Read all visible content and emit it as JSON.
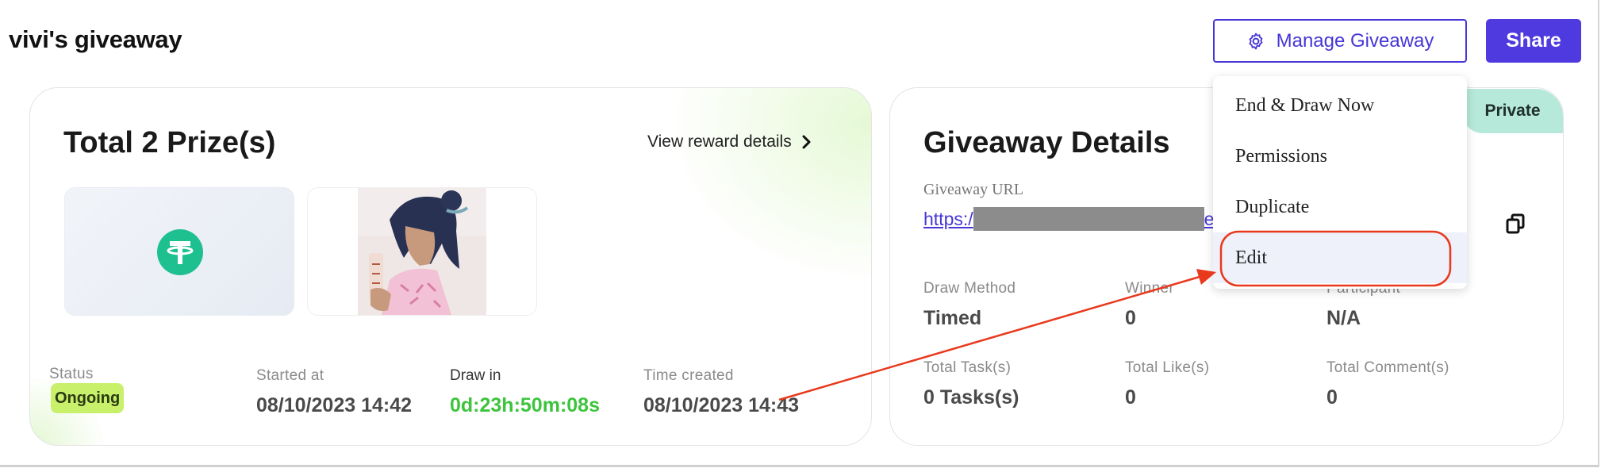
{
  "page": {
    "title": "vivi's giveaway"
  },
  "header": {
    "manage_label": "Manage Giveaway",
    "share_label": "Share"
  },
  "prizes": {
    "title": "Total 2 Prize(s)",
    "view_details_label": "View reward details",
    "status_label": "Status",
    "status_value": "Ongoing",
    "started_label": "Started at",
    "started_value": "08/10/2023 14:42",
    "draw_label": "Draw in",
    "draw_value": "0d:23h:50m:08s",
    "created_label": "Time created",
    "created_value": "08/10/2023 14:43"
  },
  "details": {
    "title": "Giveaway Details",
    "url_label": "Giveaway URL",
    "url_prefix": "https:/",
    "url_suffix": "e",
    "private_label": "Private",
    "stats": [
      {
        "label": "Draw Method",
        "value": "Timed"
      },
      {
        "label": "Winner",
        "value": "0"
      },
      {
        "label": "Participant",
        "value": "N/A"
      },
      {
        "label": "Total Task(s)",
        "value": "0 Tasks(s)"
      },
      {
        "label": "Total Like(s)",
        "value": "0"
      },
      {
        "label": "Total Comment(s)",
        "value": "0"
      }
    ]
  },
  "dropdown": {
    "items": [
      {
        "label": "End & Draw Now"
      },
      {
        "label": "Permissions"
      },
      {
        "label": "Duplicate"
      },
      {
        "label": "Edit"
      }
    ]
  },
  "colors": {
    "accent": "#4636d8",
    "share_bg": "#4f3ae0",
    "ongoing_badge": "#c8f06a",
    "draw_countdown": "#3cc43c",
    "tether_green": "#1ec08f",
    "private_badge": "#b7e9da",
    "annotation": "#e8391d"
  },
  "icons": {
    "manage": "gear-icon",
    "view_details": "chevron-right-icon",
    "copy": "copy-icon",
    "prize_1": "tether-icon"
  }
}
